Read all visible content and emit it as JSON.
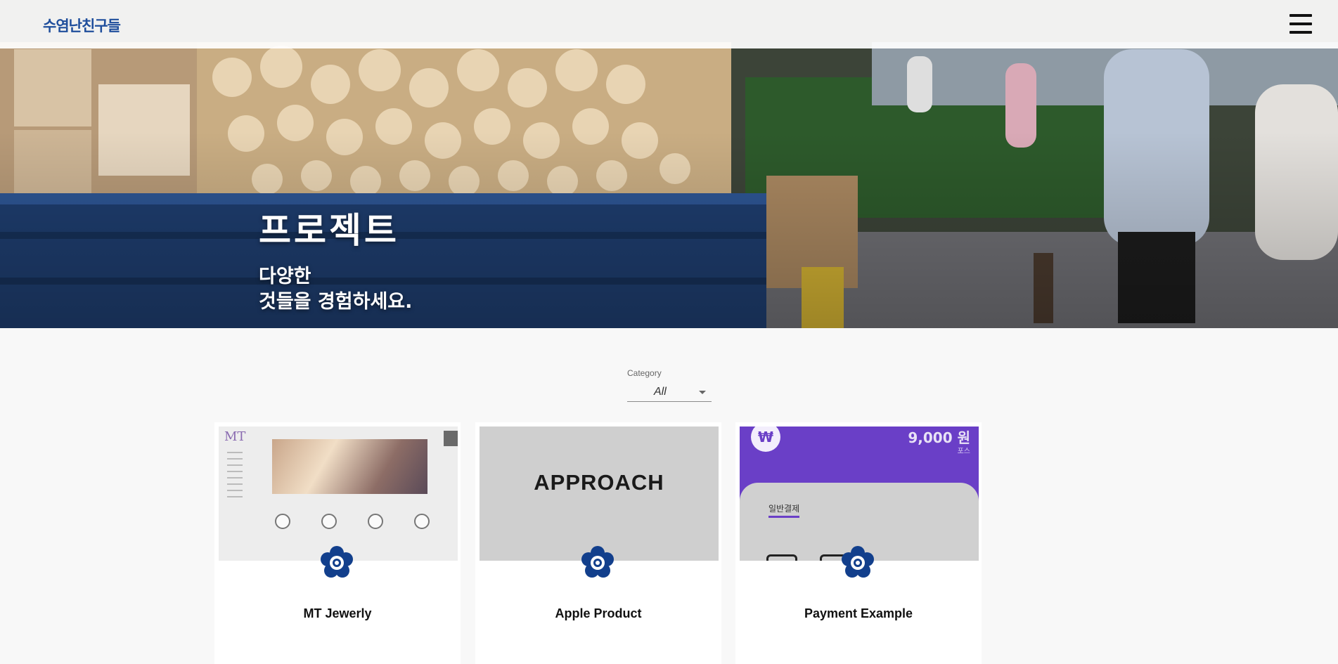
{
  "header": {
    "logo_text": "수염난친구들",
    "menu_icon": "hamburger-menu-icon"
  },
  "hero": {
    "title": "프로젝트",
    "subtitle_line1": "다양한",
    "subtitle_line2": "것들을 경험하세요."
  },
  "filter": {
    "label": "Category",
    "selected": "All"
  },
  "projects": [
    {
      "title": "MT Jewerly",
      "thumb_text": "MT"
    },
    {
      "title": "Apple Product",
      "thumb_text": "APPROACH"
    },
    {
      "title": "Payment Example",
      "thumb_amount": "9,000 원",
      "thumb_amount_sub": "포스",
      "thumb_currency": "₩",
      "thumb_tab": "일반결제"
    }
  ],
  "colors": {
    "brand": "#1f4e9c",
    "payment_purple": "#6a3fc7",
    "emblem_blue": "#123f8c"
  }
}
